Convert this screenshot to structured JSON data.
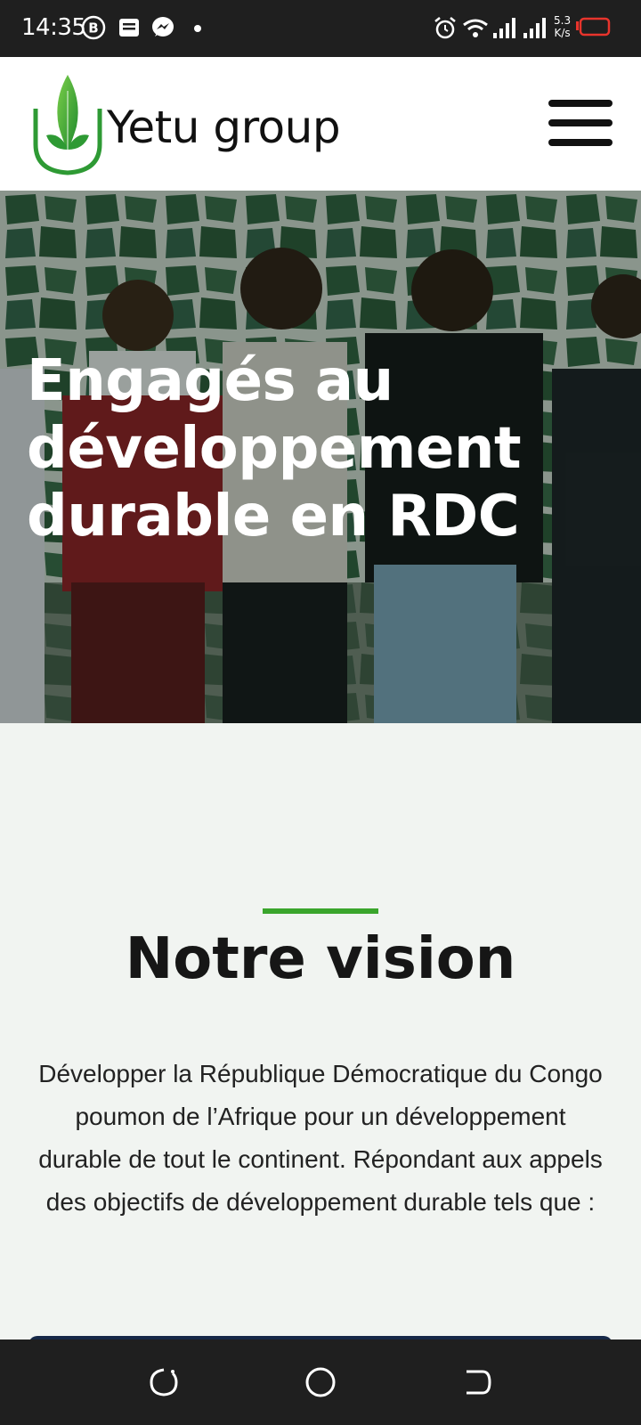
{
  "status_bar": {
    "time": "14:35",
    "notification_icons": [
      "b-badge-icon",
      "message-icon",
      "messenger-icon",
      "dot-icon"
    ],
    "system_icons": [
      "alarm-icon",
      "wifi-icon",
      "signal-icon",
      "signal-icon",
      "battery-icon"
    ],
    "speed_value": "5.3",
    "speed_unit": "K/s"
  },
  "header": {
    "brand": "Yetu group",
    "logo_icon": "leaf-logo-icon",
    "menu_icon": "hamburger-menu-icon",
    "accent_color": "#3aa52c"
  },
  "hero": {
    "title": "Engagés au développement durable en RDC"
  },
  "vision": {
    "title": "Notre vision",
    "text": "Développer la République Démocratique du Congo poumon de l’Afrique pour un développement durable de tout le continent. Répondant aux appels des objectifs de développement durable tels que :"
  },
  "nav_bar": {
    "icons": [
      "recent-apps-icon",
      "home-icon",
      "back-icon"
    ]
  }
}
